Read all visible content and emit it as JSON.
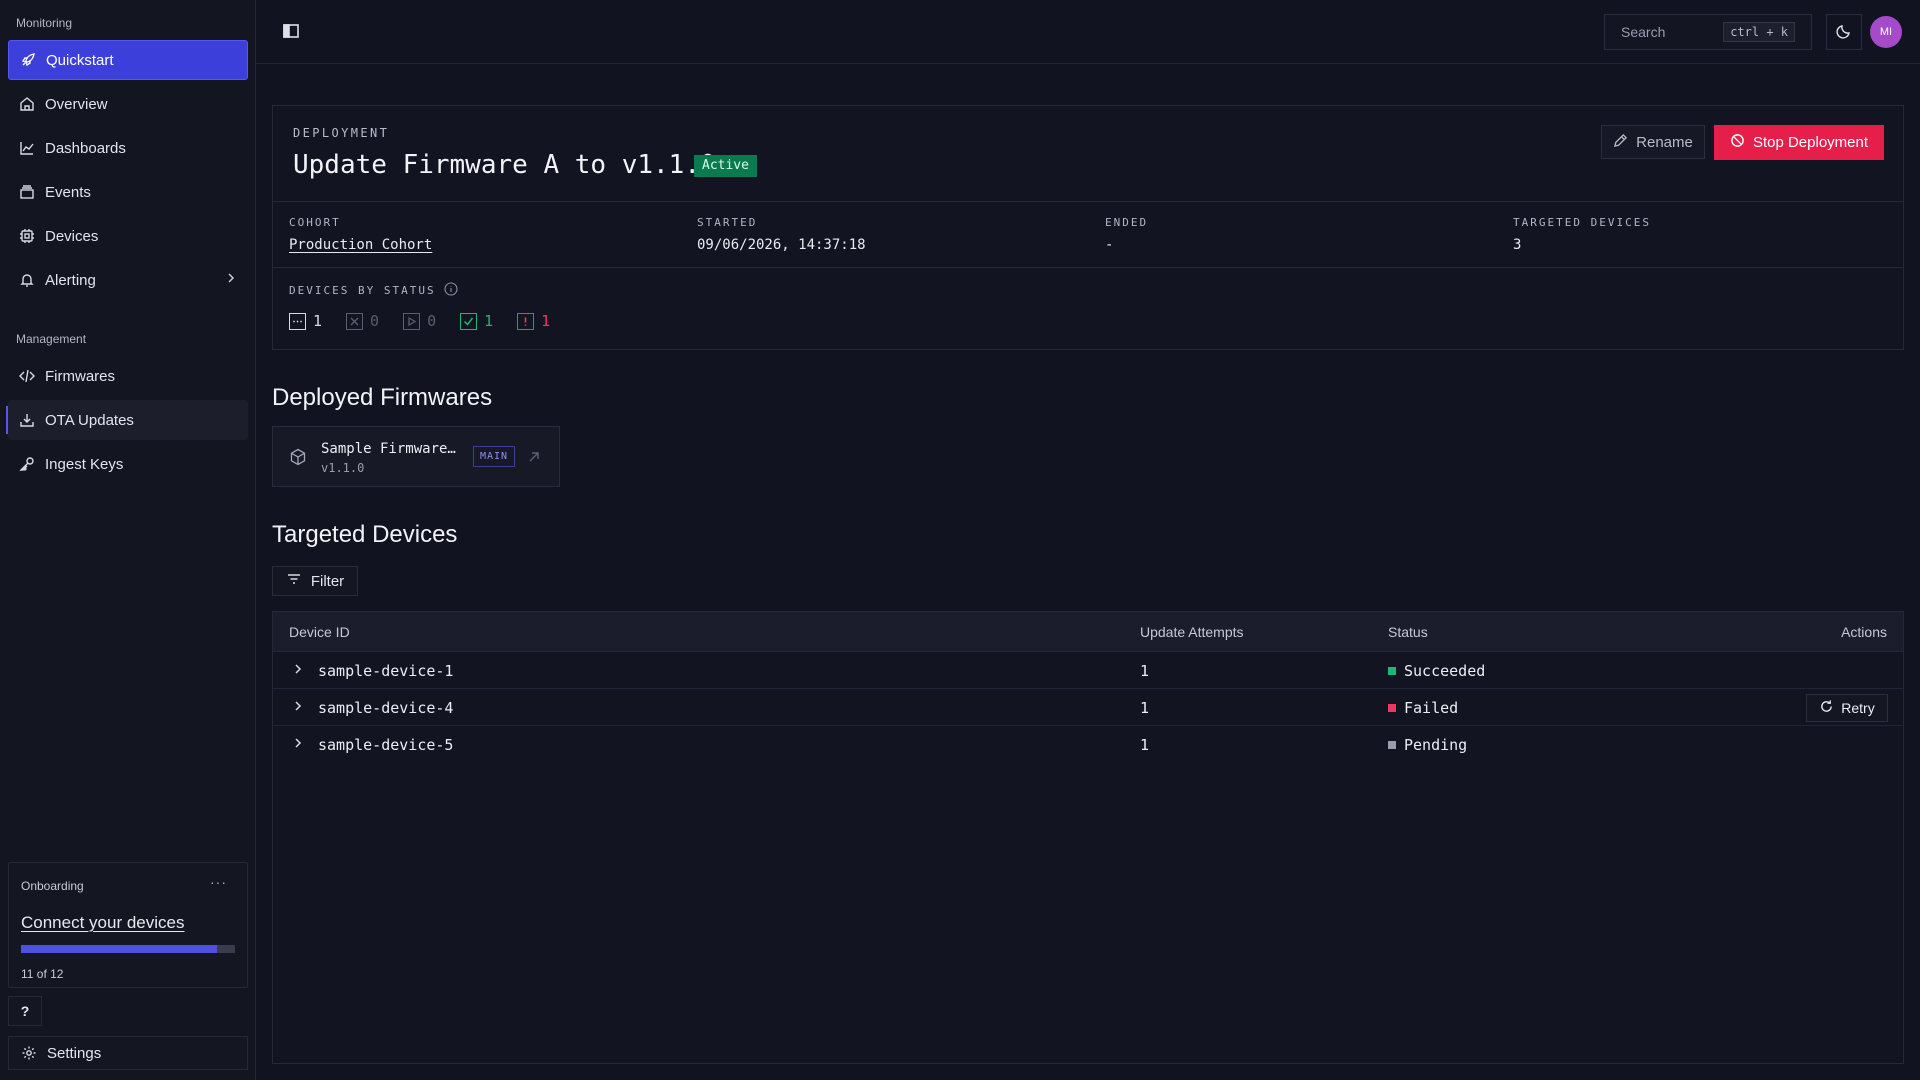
{
  "sidebar": {
    "section_monitoring": "Monitoring",
    "section_management": "Management",
    "items": [
      {
        "label": "Quickstart",
        "icon": "rocket-icon"
      },
      {
        "label": "Overview",
        "icon": "home-icon"
      },
      {
        "label": "Dashboards",
        "icon": "line-chart-icon"
      },
      {
        "label": "Events",
        "icon": "stack-icon"
      },
      {
        "label": "Devices",
        "icon": "chip-icon"
      },
      {
        "label": "Alerting",
        "icon": "bell-icon"
      },
      {
        "label": "Firmwares",
        "icon": "code-icon"
      },
      {
        "label": "OTA Updates",
        "icon": "download-icon"
      },
      {
        "label": "Ingest Keys",
        "icon": "key-icon"
      }
    ],
    "onboarding": {
      "title": "Onboarding",
      "more": "···",
      "link": "Connect your devices",
      "progress_fraction": 0.9167,
      "progress_text": "11 of 12"
    },
    "help_label": "?",
    "settings_label": "Settings"
  },
  "topbar": {
    "search_placeholder": "Search",
    "search_shortcut": "ctrl + k",
    "avatar_initials": "MI"
  },
  "deployment": {
    "label": "DEPLOYMENT",
    "title": "Update Firmware A to v1.1.0",
    "badge": "Active",
    "rename_label": "Rename",
    "stop_label": "Stop Deployment",
    "meta": {
      "cohort_label": "COHORT",
      "cohort_value": "Production Cohort",
      "started_label": "STARTED",
      "started_value": "09/06/2026, 14:37:18",
      "ended_label": "ENDED",
      "ended_value": "-",
      "targeted_label": "TARGETED DEVICES",
      "targeted_value": "3"
    },
    "devices_by_status_label": "DEVICES BY STATUS",
    "status_counts": [
      {
        "kind": "pending",
        "count": "1",
        "color": "#d6d8e3"
      },
      {
        "kind": "cancelled",
        "count": "0",
        "color": "#5b5e70"
      },
      {
        "kind": "in-progress",
        "count": "0",
        "color": "#5b5e70"
      },
      {
        "kind": "succeeded",
        "count": "1",
        "color": "#19b87a"
      },
      {
        "kind": "failed",
        "count": "1",
        "color": "#f0375f"
      }
    ]
  },
  "deployed_firmwares": {
    "heading": "Deployed Firmwares",
    "items": [
      {
        "name": "Sample Firmware…",
        "version": "v1.1.0",
        "tag": "MAIN"
      }
    ]
  },
  "targeted_devices": {
    "heading": "Targeted Devices",
    "filter_label": "Filter",
    "columns": [
      "Device ID",
      "Update Attempts",
      "Status",
      "Actions"
    ],
    "rows": [
      {
        "device_id": "sample-device-1",
        "attempts": "1",
        "status": "Succeeded",
        "status_color": "#19b87a",
        "action": ""
      },
      {
        "device_id": "sample-device-4",
        "attempts": "1",
        "status": "Failed",
        "status_color": "#f0375f",
        "action": "Retry"
      },
      {
        "device_id": "sample-device-5",
        "attempts": "1",
        "status": "Pending",
        "status_color": "#9a9cab",
        "action": ""
      }
    ]
  },
  "colors": {
    "accent": "#3c3fd9",
    "danger": "#e51e4a",
    "success": "#0b7a4f"
  }
}
